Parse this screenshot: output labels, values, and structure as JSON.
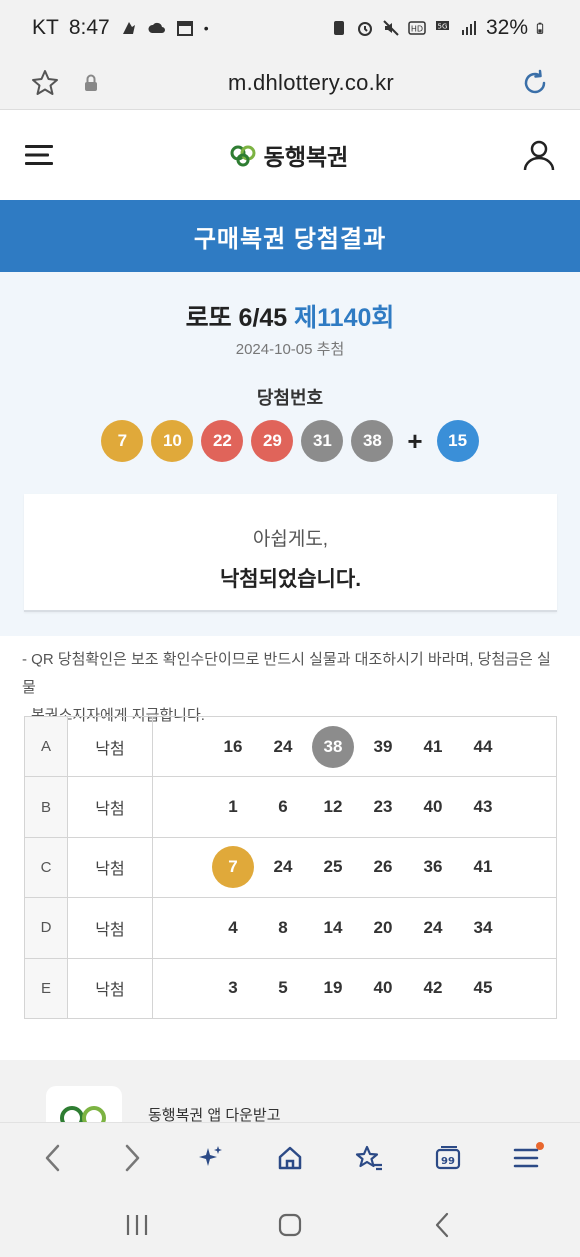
{
  "status_bar": {
    "carrier": "KT",
    "time": "8:47",
    "battery": "32%"
  },
  "browser": {
    "url": "m.dhlottery.co.kr"
  },
  "site": {
    "logo_text": "동행복권",
    "page_title": "구매복권 당첨결과"
  },
  "result": {
    "game": "로또 6/45",
    "round": "제1140회",
    "draw_date": "2024-10-05 추첨",
    "win_label": "당첨번호",
    "winning_numbers": [
      {
        "n": "7",
        "color": "#e0a93a"
      },
      {
        "n": "10",
        "color": "#e0a93a"
      },
      {
        "n": "22",
        "color": "#e0645a"
      },
      {
        "n": "29",
        "color": "#e0645a"
      },
      {
        "n": "31",
        "color": "#8c8c8c"
      },
      {
        "n": "38",
        "color": "#8c8c8c"
      }
    ],
    "plus": "+",
    "bonus": {
      "n": "15",
      "color": "#3a8fd8"
    },
    "message_sub": "아쉽게도,",
    "message_main": "낙첨되었습니다."
  },
  "notice": {
    "line1": "- QR 당첨확인은 보조 확인수단이므로 반드시 실물과 대조하시기 바라며, 당첨금은 실물",
    "line2": "복권소지자에게 지급합니다."
  },
  "tickets": [
    {
      "label": "A",
      "result": "낙첨",
      "numbers": [
        "16",
        "24",
        "38",
        "39",
        "41",
        "44"
      ],
      "hit": 2,
      "hit_color": "#8c8c8c"
    },
    {
      "label": "B",
      "result": "낙첨",
      "numbers": [
        "1",
        "6",
        "12",
        "23",
        "40",
        "43"
      ],
      "hit": -1,
      "hit_color": ""
    },
    {
      "label": "C",
      "result": "낙첨",
      "numbers": [
        "7",
        "24",
        "25",
        "26",
        "36",
        "41"
      ],
      "hit": 0,
      "hit_color": "#e0a93a"
    },
    {
      "label": "D",
      "result": "낙첨",
      "numbers": [
        "4",
        "8",
        "14",
        "20",
        "24",
        "34"
      ],
      "hit": -1,
      "hit_color": ""
    },
    {
      "label": "E",
      "result": "낙첨",
      "numbers": [
        "3",
        "5",
        "19",
        "40",
        "42",
        "45"
      ],
      "hit": -1,
      "hit_color": ""
    }
  ],
  "footer": {
    "app_download": "동행복권 앱 다운받고"
  },
  "colors": {
    "brand_blue": "#2f7bc3",
    "summary_bg": "#f1f6fb"
  }
}
